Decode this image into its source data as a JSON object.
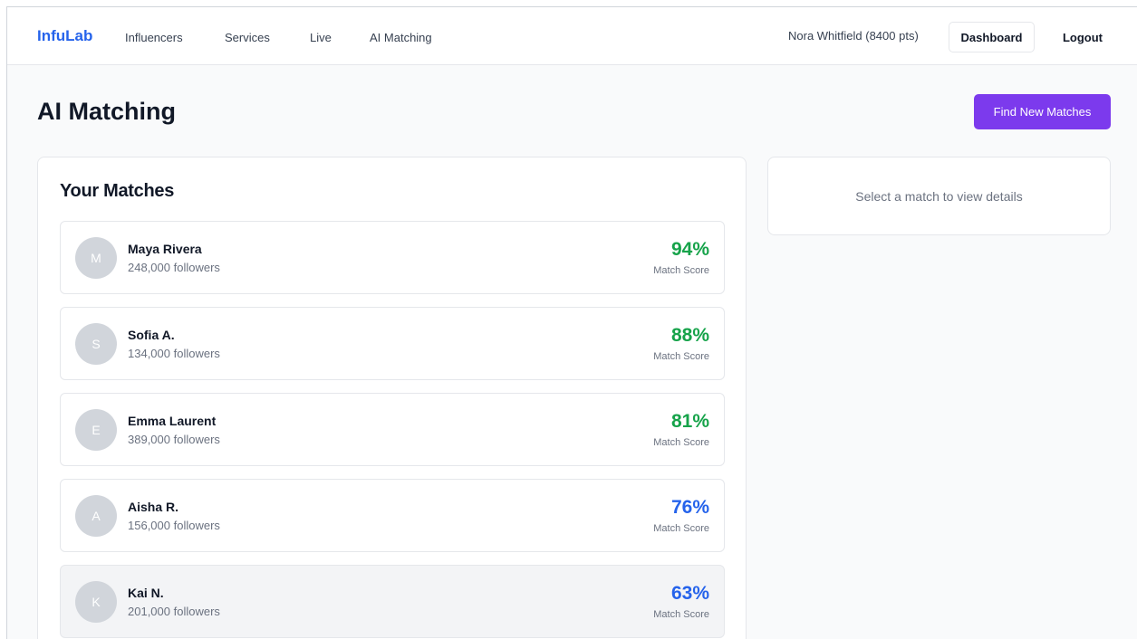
{
  "nav": {
    "brand": "InfuLab",
    "links": [
      {
        "label": "Influencers"
      },
      {
        "label": "Services"
      },
      {
        "label": "Live"
      },
      {
        "label": "AI Matching"
      }
    ],
    "user": "Nora Whitfield (8400 pts)",
    "dashboard_label": "Dashboard",
    "logout_label": "Logout"
  },
  "page": {
    "title": "AI Matching",
    "find_button": "Find New Matches"
  },
  "matches": {
    "title": "Your Matches",
    "score_label": "Match Score",
    "items": [
      {
        "initial": "M",
        "name": "Maya Rivera",
        "followers": "248,000 followers",
        "score": "94%",
        "score_color": "#16a34a"
      },
      {
        "initial": "S",
        "name": "Sofia A.",
        "followers": "134,000 followers",
        "score": "88%",
        "score_color": "#16a34a"
      },
      {
        "initial": "E",
        "name": "Emma Laurent",
        "followers": "389,000 followers",
        "score": "81%",
        "score_color": "#16a34a"
      },
      {
        "initial": "A",
        "name": "Aisha R.",
        "followers": "156,000 followers",
        "score": "76%",
        "score_color": "#2563eb"
      },
      {
        "initial": "K",
        "name": "Kai N.",
        "followers": "201,000 followers",
        "score": "63%",
        "score_color": "#2563eb"
      }
    ]
  },
  "details": {
    "placeholder": "Select a match to view details"
  },
  "colors": {
    "brand": "#2563eb",
    "primary_button": "#7c3aed",
    "score_high": "#16a34a",
    "score_mid": "#2563eb"
  }
}
